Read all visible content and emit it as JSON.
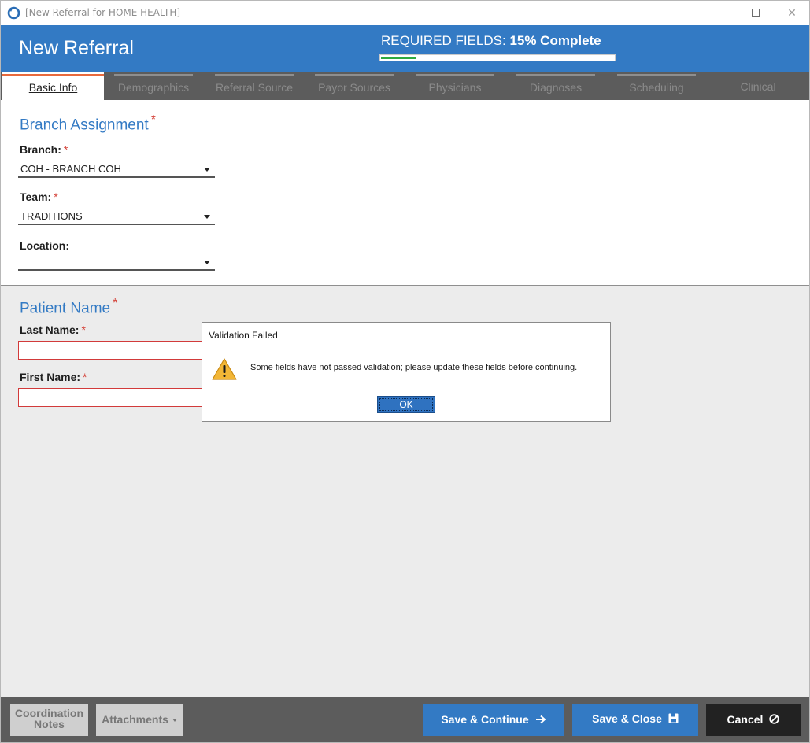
{
  "window": {
    "title": "[New Referral for HOME HEALTH]",
    "controls": {
      "minimize": "minimize",
      "maximize": "maximize",
      "close": "✕"
    }
  },
  "header": {
    "title": "New Referral",
    "required_label": "REQUIRED FIELDS:",
    "required_value": "15% Complete",
    "progress_fraction": 0.15,
    "progress_color": "#2eaa3f",
    "accent_color": "#337ac4"
  },
  "tabs": [
    {
      "label": "Basic Info",
      "active": true
    },
    {
      "label": "Demographics",
      "active": false
    },
    {
      "label": "Referral Source",
      "active": false
    },
    {
      "label": "Payor Sources",
      "active": false
    },
    {
      "label": "Physicians",
      "active": false
    },
    {
      "label": "Diagnoses",
      "active": false
    },
    {
      "label": "Scheduling",
      "active": false
    },
    {
      "label": "Clinical",
      "active": false
    }
  ],
  "branch_section": {
    "title": "Branch Assignment",
    "required_mark": "*",
    "branch": {
      "label": "Branch:",
      "value": "COH - BRANCH COH"
    },
    "team": {
      "label": "Team:",
      "value": "TRADITIONS"
    },
    "location": {
      "label": "Location:",
      "value": ""
    }
  },
  "patient_section": {
    "title": "Patient Name",
    "required_mark": "*",
    "last_name": {
      "label": "Last Name:",
      "value": ""
    },
    "first_name": {
      "label": "First Name:",
      "value": ""
    }
  },
  "dialog": {
    "title": "Validation Failed",
    "icon": "warning-icon",
    "message": "Some fields have not passed validation; please update these fields before continuing.",
    "ok_label": "OK"
  },
  "footer": {
    "coordination_notes_line1": "Coordination",
    "coordination_notes_line2": "Notes",
    "attachments_label": "Attachments",
    "save_continue_label": "Save & Continue",
    "save_close_label": "Save & Close",
    "cancel_label": "Cancel"
  }
}
